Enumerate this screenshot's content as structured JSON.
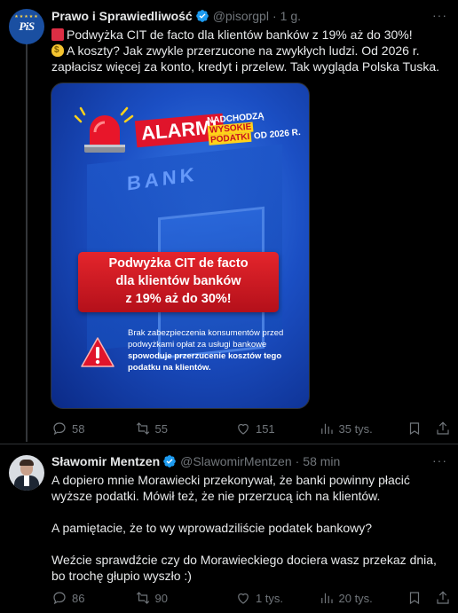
{
  "tweets": [
    {
      "author_name": "Prawo i Sprawiedliwość",
      "handle": "@pisorgpl",
      "time": "1 g.",
      "avatar_text": "PiS",
      "line1": "Podwyżka CIT de facto dla klientów banków z 19% aż do 30%!",
      "line2": "A koszty? Jak zwykle przerzucone na zwykłych ludzi. Od 2026 r. zapłacisz więcej za konto, kredyt i przelew. Tak wygląda Polska Tuska.",
      "graphic": {
        "alarm": "ALARM!",
        "nadchodza": "NADCHODZĄ",
        "wysokie": "WYSOKIE",
        "podatki": "PODATKI",
        "od_year": "OD 2026 R.",
        "bank_word": "BANK",
        "banner_l1": "Podwyżka CIT de facto",
        "banner_l2": "dla klientów banków",
        "banner_l3": "z 19% aż do 30%!",
        "warn_a": "Brak zabezpieczenia konsumentów przed podwyżkami opłat za usługi bankowe ",
        "warn_b": "spowoduje przerzucenie kosztów tego podatku na klientów."
      },
      "stats": {
        "replies": "58",
        "retweets": "55",
        "likes": "151",
        "views": "35 tys."
      }
    },
    {
      "author_name": "Sławomir Mentzen",
      "handle": "@SlawomirMentzen",
      "time": "58 min",
      "para1": "A dopiero mnie Morawiecki przekonywał, że banki powinny płacić wyższe podatki. Mówił też, że nie przerzucą ich na klientów.",
      "para2": "A pamiętacie, że to wy wprowadziliście podatek bankowy?",
      "para3": "Weźcie sprawdźcie czy do Morawieckiego dociera wasz przekaz dnia, bo trochę głupio wyszło :)",
      "stats": {
        "replies": "86",
        "retweets": "90",
        "likes": "1 tys.",
        "views": "20 tys."
      }
    }
  ],
  "colors": {
    "background": "#000000",
    "text": "#e7e9ea",
    "muted": "#71767b",
    "verified": "#1d9bf0",
    "divider": "#2f3336"
  },
  "icons": [
    "more-icon",
    "verified-icon",
    "reply-icon",
    "retweet-icon",
    "like-icon",
    "views-icon",
    "bookmark-icon",
    "share-icon"
  ]
}
